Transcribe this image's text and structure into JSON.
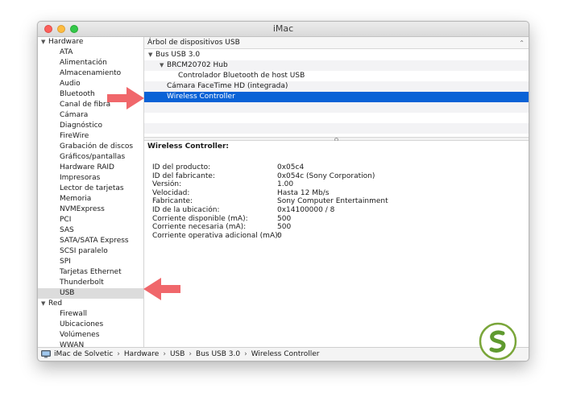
{
  "window": {
    "title": "iMac"
  },
  "sidebar": {
    "groups": [
      {
        "label": "Hardware",
        "items": [
          "ATA",
          "Alimentación",
          "Almacenamiento",
          "Audio",
          "Bluetooth",
          "Canal de fibra",
          "Cámara",
          "Diagnóstico",
          "FireWire",
          "Grabación de discos",
          "Gráficos/pantallas",
          "Hardware RAID",
          "Impresoras",
          "Lector de tarjetas",
          "Memoria",
          "NVMExpress",
          "PCI",
          "SAS",
          "SATA/SATA Express",
          "SCSI paralelo",
          "SPI",
          "Tarjetas Ethernet",
          "Thunderbolt",
          "USB"
        ]
      },
      {
        "label": "Red",
        "items": [
          "Firewall",
          "Ubicaciones",
          "Volúmenes",
          "WWAN"
        ]
      }
    ],
    "selected": "USB"
  },
  "tree": {
    "header": "Árbol de dispositivos USB",
    "rows": [
      {
        "label": "Bus USB 3.0",
        "level": 0,
        "disclosure": true
      },
      {
        "label": "BRCM20702 Hub",
        "level": 1,
        "disclosure": true
      },
      {
        "label": "Controlador Bluetooth de host USB",
        "level": 2,
        "disclosure": false
      },
      {
        "label": "Cámara FaceTime HD (integrada)",
        "level": 1,
        "disclosure": false
      },
      {
        "label": "Wireless Controller",
        "level": 1,
        "disclosure": false,
        "selected": true
      }
    ]
  },
  "detail": {
    "title": "Wireless Controller:",
    "properties": [
      {
        "label": "ID del producto:",
        "value": "0x05c4"
      },
      {
        "label": "ID del fabricante:",
        "value": "0x054c  (Sony Corporation)"
      },
      {
        "label": "Versión:",
        "value": "1.00"
      },
      {
        "label": "Velocidad:",
        "value": "Hasta 12 Mb/s"
      },
      {
        "label": "Fabricante:",
        "value": "Sony Computer Entertainment"
      },
      {
        "label": "ID de la ubicación:",
        "value": "0x14100000 / 8"
      },
      {
        "label": "Corriente disponible (mA):",
        "value": "500"
      },
      {
        "label": "Corriente necesaria (mA):",
        "value": "500"
      },
      {
        "label": "Corriente operativa adicional (mA):",
        "value": "0"
      }
    ]
  },
  "pathbar": {
    "crumbs": [
      "iMac de Solvetic",
      "Hardware",
      "USB",
      "Bus USB 3.0",
      "Wireless Controller"
    ],
    "separator": "›"
  },
  "colors": {
    "selection": "#0a62d6",
    "sidebar_selection": "#dcdcdc",
    "arrow": "#f0676b",
    "close": "#fc605c",
    "minimize": "#fdbc40",
    "maximize": "#34c84a"
  },
  "icons": [
    "imac-icon",
    "disclosure-triangle-icon",
    "pointer-arrow-icon",
    "solvetic-logo-icon"
  ]
}
